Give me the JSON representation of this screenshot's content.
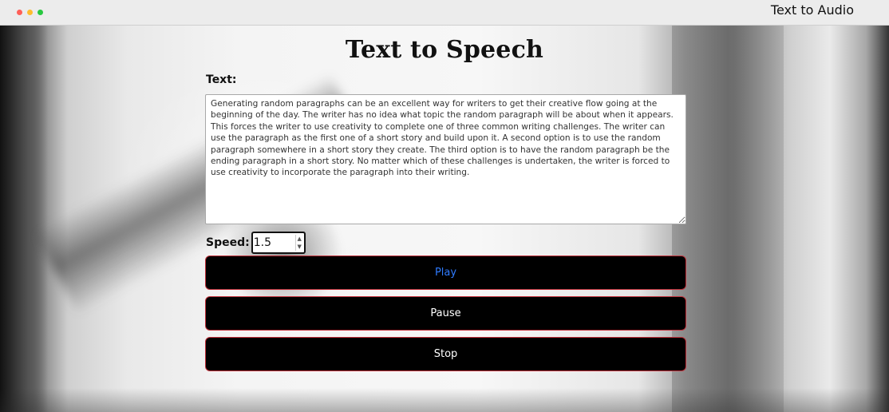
{
  "window": {
    "title": "Text to Audio",
    "traffic_lights": [
      "#ff5f57",
      "#febc2e",
      "#28c840"
    ]
  },
  "main": {
    "heading": "Text to Speech",
    "text_label": "Text:",
    "text_value": "Generating random paragraphs can be an excellent way for writers to get their creative flow going at the beginning of the day. The writer has no idea what topic the random paragraph will be about when it appears. This forces the writer to use creativity to complete one of three common writing challenges. The writer can use the paragraph as the first one of a short story and build upon it. A second option is to use the random paragraph somewhere in a short story they create. The third option is to have the random paragraph be the ending paragraph in a short story. No matter which of these challenges is undertaken, the writer is forced to use creativity to incorporate the paragraph into their writing.",
    "speed_label": "Speed:",
    "speed_value": "1.5",
    "buttons": {
      "play": "Play",
      "pause": "Pause",
      "stop": "Stop"
    }
  },
  "colors": {
    "button_bg": "#000000",
    "button_border": "#c0303a",
    "play_text": "#2f7bff",
    "button_text": "#ffffff"
  }
}
